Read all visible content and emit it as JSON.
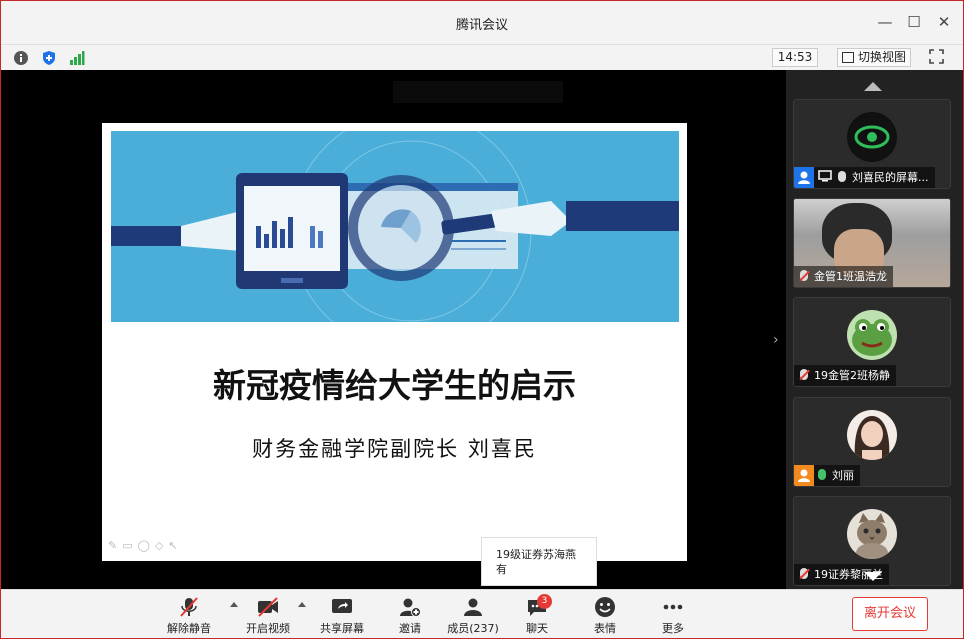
{
  "window": {
    "title": "腾讯会议"
  },
  "toolbar": {
    "time": "14:53",
    "switch_view_label": "切换视图"
  },
  "stage": {
    "banner_text": "",
    "slide": {
      "title": "新冠疫情给大学生的启示",
      "subtitle": "财务金融学院副院长  刘喜民"
    },
    "chat_popup": {
      "line1": "19级证券苏海燕",
      "line2": "有"
    }
  },
  "participants": [
    {
      "name": "刘喜民的屏幕...",
      "mic": "on-white",
      "avatar": "eye-icon"
    },
    {
      "name": "金管1班温浩龙",
      "mic": "muted",
      "avatar": "camera-video"
    },
    {
      "name": "19金管2班杨静",
      "mic": "muted",
      "avatar": "frog-avatar"
    },
    {
      "name": "刘丽",
      "mic": "on",
      "avatar": "woman-photo"
    },
    {
      "name": "19证券黎丽兰",
      "mic": "muted",
      "avatar": "cat-photo"
    }
  ],
  "bottombar": {
    "unmute": "解除静音",
    "start_video": "开启视频",
    "share_screen": "共享屏幕",
    "invite": "邀请",
    "members": "成员(237)",
    "chat": "聊天",
    "chat_badge": "3",
    "emoji": "表情",
    "more": "更多",
    "leave": "离开会议"
  },
  "colors": {
    "accent_red": "#e53935",
    "slide_blue": "#4baed8",
    "green": "#43c26a"
  }
}
